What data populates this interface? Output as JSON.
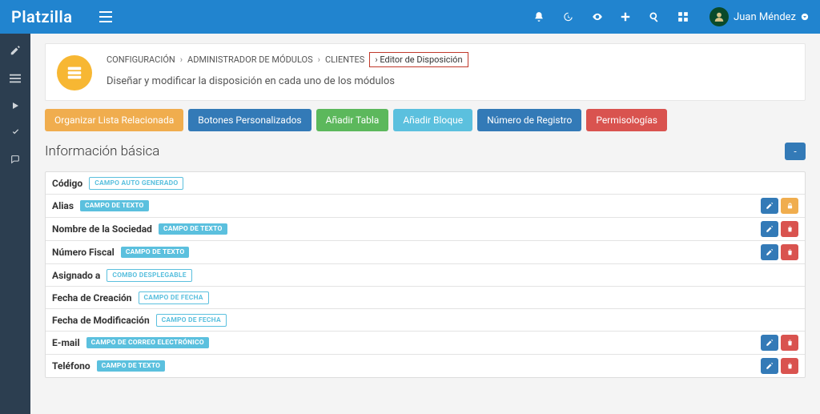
{
  "app": {
    "name": "Platzilla"
  },
  "user": {
    "name": "Juan Méndez"
  },
  "breadcrumb": {
    "items": [
      "CONFIGURACIÓN",
      "ADMINISTRADOR DE MÓDULOS",
      "CLIENTES",
      "Editor de Disposición"
    ]
  },
  "page": {
    "subtitle": "Diseñar y modificar la disposición en cada uno de los módulos"
  },
  "buttons": {
    "organize": "Organizar Lista Relacionada",
    "custom": "Botones Personalizados",
    "addTable": "Añadir Tabla",
    "addBlock": "Añadir Bloque",
    "recNum": "Número de Registro",
    "perms": "Permisologías"
  },
  "section": {
    "title": "Información básica",
    "collapse": "-"
  },
  "fieldTags": {
    "auto": "CAMPO AUTO GENERADO",
    "text": "CAMPO DE TEXTO",
    "combo": "COMBO DESPLEGABLE",
    "date": "CAMPO DE FECHA",
    "email": "CAMPO DE CORREO ELECTRÓNICO"
  },
  "fields": [
    {
      "label": "Código",
      "tagKey": "auto",
      "tagStyle": "out",
      "actions": []
    },
    {
      "label": "Alias",
      "tagKey": "text",
      "tagStyle": "fill",
      "actions": [
        "edit",
        "lock"
      ]
    },
    {
      "label": "Nombre de la Sociedad",
      "tagKey": "text",
      "tagStyle": "fill",
      "actions": [
        "edit",
        "delete"
      ]
    },
    {
      "label": "Número Fiscal",
      "tagKey": "text",
      "tagStyle": "fill",
      "actions": [
        "edit",
        "delete"
      ]
    },
    {
      "label": "Asignado a",
      "tagKey": "combo",
      "tagStyle": "out",
      "actions": []
    },
    {
      "label": "Fecha de Creación",
      "tagKey": "date",
      "tagStyle": "out",
      "actions": []
    },
    {
      "label": "Fecha de Modificación",
      "tagKey": "date",
      "tagStyle": "out",
      "actions": []
    },
    {
      "label": "E-mail",
      "tagKey": "email",
      "tagStyle": "fill",
      "actions": [
        "edit",
        "delete"
      ]
    },
    {
      "label": "Teléfono",
      "tagKey": "text",
      "tagStyle": "fill",
      "actions": [
        "edit",
        "delete"
      ]
    }
  ]
}
